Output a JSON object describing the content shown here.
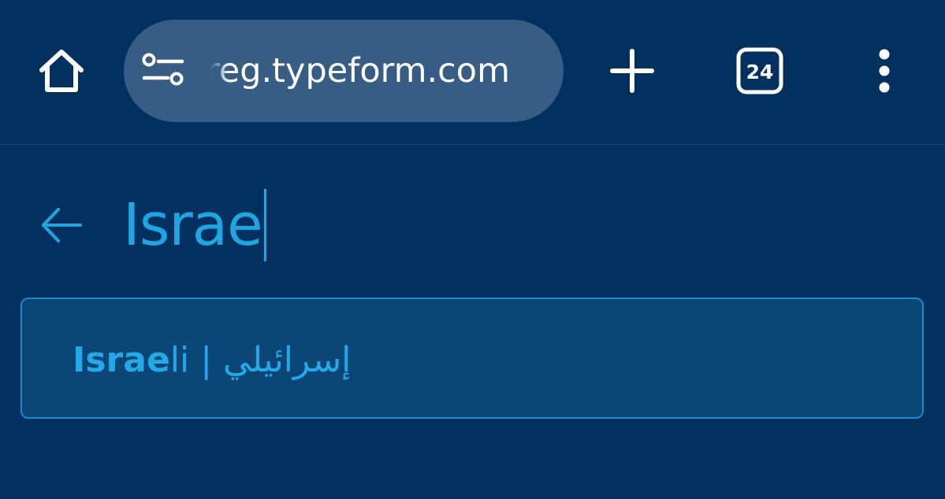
{
  "browser": {
    "url": "reg.typeform.com",
    "tab_count": "24",
    "icons": {
      "home": "home-icon",
      "site_settings": "tune-icon",
      "new_tab": "plus-icon",
      "tabs": "tab-switcher-icon",
      "menu": "more-vert-icon"
    }
  },
  "search": {
    "query": "Israe",
    "back_icon": "arrow-left-icon"
  },
  "suggestion": {
    "match": "Israe",
    "rest": "li | إسرائيلي"
  },
  "colors": {
    "background": "#023160",
    "url_pill": "#385d85",
    "accent": "#1fa6e2",
    "option_border": "#1d8ad0",
    "option_bg": "#0b4676"
  }
}
